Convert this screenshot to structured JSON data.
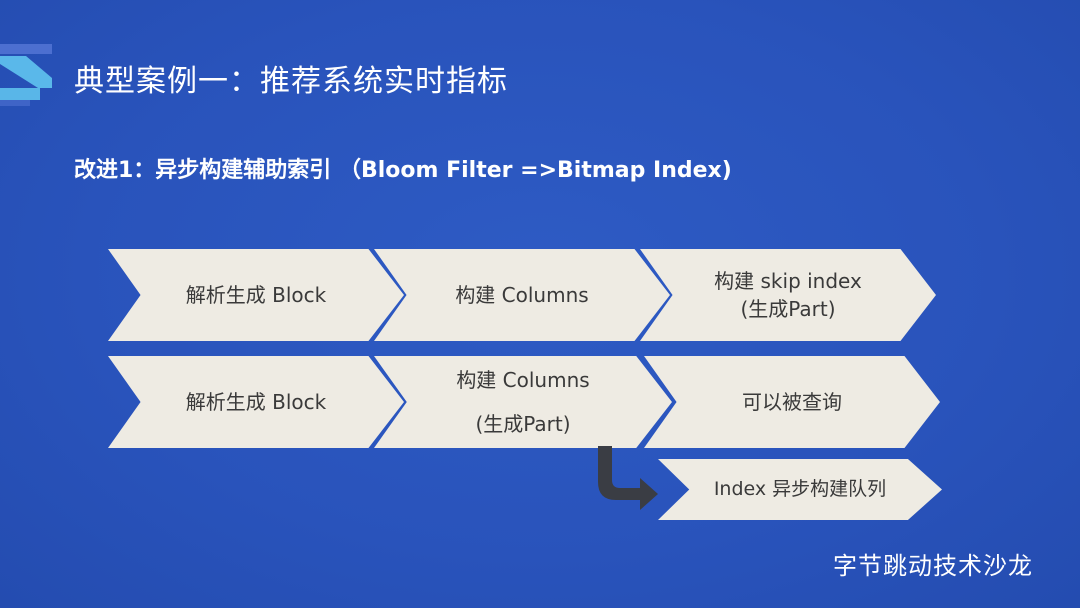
{
  "colors": {
    "background": "#2a56bd",
    "chevron_fill": "#eeebe3",
    "chevron_text": "#3a3a3a",
    "arrow": "#3a3d44"
  },
  "slide": {
    "title": "典型案例一：推荐系统实时指标",
    "subtitle": "改进1：异步构建辅助索引 （Bloom Filter =>Bitmap Index)",
    "brand": "字节跳动技术沙龙"
  },
  "row1": {
    "step1": "解析生成 Block",
    "step2": "构建 Columns",
    "step3_line1": "构建 skip index",
    "step3_line2": "(生成Part)"
  },
  "row2": {
    "step1": "解析生成 Block",
    "step2_line1": "构建 Columns",
    "step2_line2": "(生成Part)",
    "step3": "可以被查询"
  },
  "queue": {
    "label": "Index 异步构建队列"
  },
  "icons": {
    "logo": "bytedance-stripes-logo",
    "arrow": "bend-down-right-arrow-icon"
  }
}
